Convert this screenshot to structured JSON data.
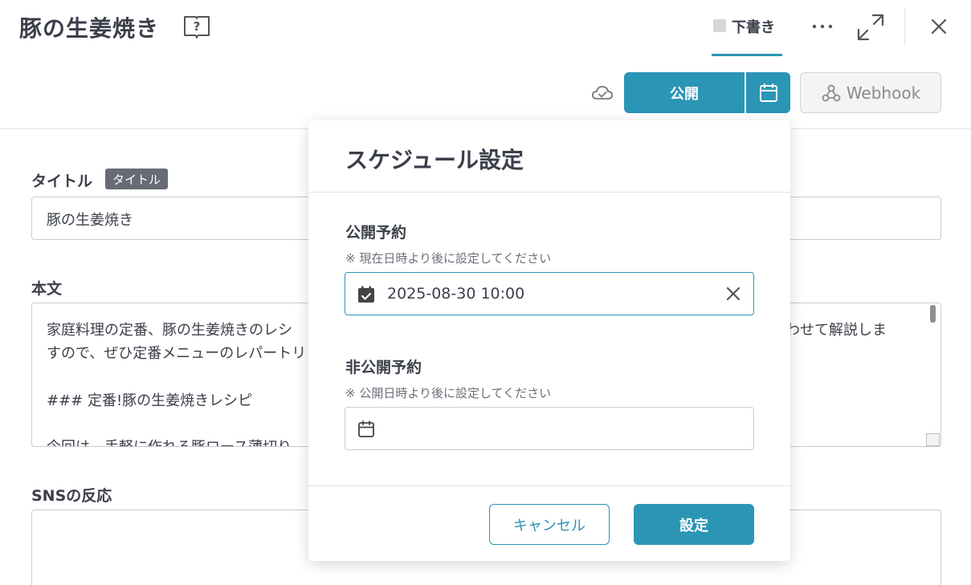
{
  "header": {
    "title": "豚の生姜焼き",
    "status_label": "下書き",
    "accent_color": "#2b95b5"
  },
  "toolbar": {
    "publish_label": "公開",
    "webhook_label": "Webhook"
  },
  "form": {
    "title_label": "タイトル",
    "title_tag": "タイトル",
    "title_value": "豚の生姜焼き",
    "body_label": "本文",
    "body_lines": [
      "家庭料理の定番、豚の生姜焼きのレシ",
      "すので、ぜひ定番メニューのレパートリ",
      "### 定番!豚の生姜焼きレシピ",
      "今回は、手軽に作れる豚ロース薄切り"
    ],
    "body_line1_tail": "わせて解説しま",
    "sns_label": "SNSの反応"
  },
  "modal": {
    "title": "スケジュール設定",
    "publish_schedule_label": "公開予約",
    "publish_schedule_note": "※ 現在日時より後に設定してください",
    "publish_schedule_value": "2025-08-30 10:00",
    "unpublish_schedule_label": "非公開予約",
    "unpublish_schedule_note": "※ 公開日時より後に設定してください",
    "cancel_label": "キャンセル",
    "confirm_label": "設定"
  }
}
